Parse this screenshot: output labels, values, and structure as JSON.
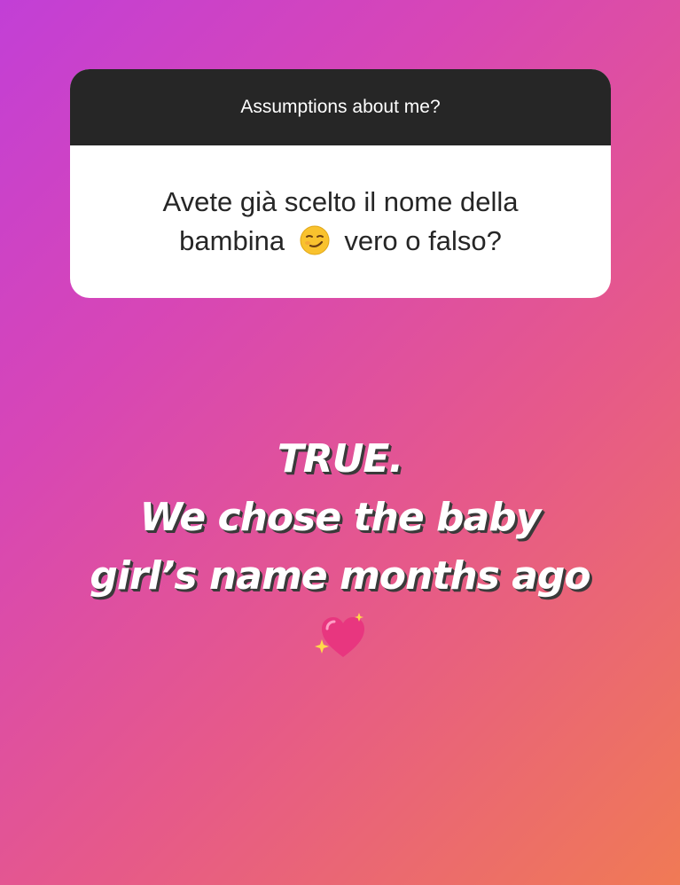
{
  "question_box": {
    "prompt": "Assumptions about me?",
    "question_part1": "Avete già scelto il nome della bambina",
    "question_part2": "vero o falso?"
  },
  "answer": {
    "line1": "TRUE.",
    "line2": "We chose the baby",
    "line3": "girl’s name months ago"
  },
  "icons": {
    "question_emoji": "smirking-face-icon",
    "answer_emoji": "sparkling-heart-icon"
  },
  "colors": {
    "gradient_start": "#c23fd6",
    "gradient_end": "#f07a55",
    "card_header": "#262626",
    "card_body": "#ffffff"
  }
}
